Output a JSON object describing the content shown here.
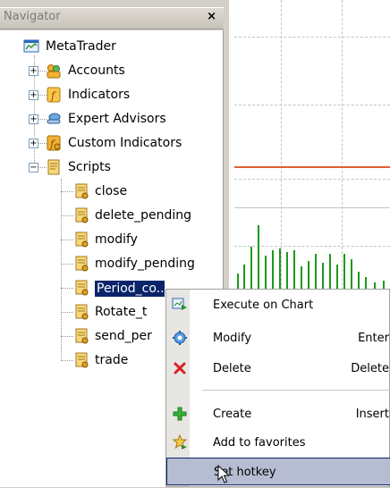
{
  "navigator": {
    "title": "Navigator",
    "close_glyph": "×",
    "root_label": "MetaTrader",
    "items": [
      {
        "label": "Accounts",
        "icon": "accounts-icon",
        "expander": "+"
      },
      {
        "label": "Indicators",
        "icon": "indicators-icon",
        "expander": "+"
      },
      {
        "label": "Expert Advisors",
        "icon": "expert-advisors-icon",
        "expander": "+"
      },
      {
        "label": "Custom Indicators",
        "icon": "custom-indicators-icon",
        "expander": "+"
      },
      {
        "label": "Scripts",
        "icon": "scripts-icon",
        "expander": "−"
      }
    ],
    "scripts": [
      {
        "label": "close"
      },
      {
        "label": "delete_pending"
      },
      {
        "label": "modify"
      },
      {
        "label": "modify_pending"
      },
      {
        "label": "Period_co..."
      },
      {
        "label": "Rotate_t"
      },
      {
        "label": "send_per"
      },
      {
        "label": "trade"
      }
    ]
  },
  "context_menu": {
    "items": [
      {
        "label": "Execute on Chart",
        "shortcut": "",
        "icon": "execute-on-chart-icon"
      },
      {
        "label": "Modify",
        "shortcut": "Enter",
        "icon": "modify-icon"
      },
      {
        "label": "Delete",
        "shortcut": "Delete",
        "icon": "delete-icon"
      },
      {
        "label": "Create",
        "shortcut": "Insert",
        "icon": "create-icon"
      },
      {
        "label": "Add to favorites",
        "shortcut": "",
        "icon": "favorites-icon"
      },
      {
        "label": "Set hotkey",
        "shortcut": "",
        "icon": ""
      }
    ]
  },
  "colors": {
    "selection": "#0a246a",
    "chart_bar": "#1c9a1c",
    "chart_level_line": "#e06030",
    "menu_highlight": "#b6bdd2"
  }
}
